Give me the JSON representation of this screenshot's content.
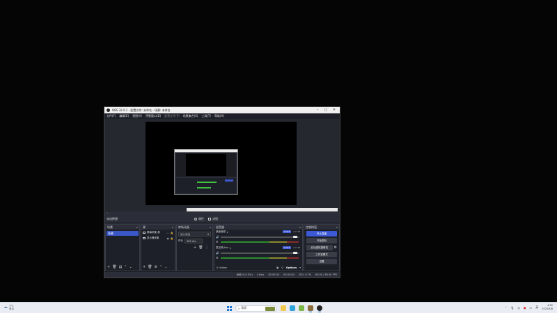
{
  "window": {
    "title": "OBS 32.0.1 - 配置文件: 未命名 - 场景: 未命名",
    "controls": [
      "–",
      "▢",
      "✕"
    ]
  },
  "menu": [
    {
      "label": "文件(F)",
      "dim": false
    },
    {
      "label": "编辑(E)",
      "dim": false
    },
    {
      "label": "视图(V)",
      "dim": false
    },
    {
      "label": "停靠窗口(D)",
      "dim": false
    },
    {
      "label": "配置文件(P)",
      "dim": true
    },
    {
      "label": "场景集合(S)",
      "dim": false
    },
    {
      "label": "工具(T)",
      "dim": false
    },
    {
      "label": "帮助(H)",
      "dim": false
    }
  ],
  "scene_bar": {
    "label": "未选择源",
    "properties": "属性",
    "filters": "滤镜"
  },
  "docks": {
    "scenes": {
      "title": "场景",
      "items": [
        "场景"
      ]
    },
    "sources": {
      "title": "源",
      "items": [
        {
          "label": "屏幕采集 源"
        },
        {
          "label": "显示器采集"
        }
      ]
    },
    "transitions": {
      "title": "转场动画",
      "selected": "淡入淡出",
      "duration_label": "时长",
      "duration_value": "300 ms"
    },
    "mixer": {
      "title": "混音器",
      "channels": [
        {
          "name": "桌面音频",
          "badge": "Global",
          "db": "0.0 dB"
        },
        {
          "name": "麦克风/Aux",
          "badge": "Global",
          "db": "0.0 dB"
        }
      ],
      "hidden": "0 hidden",
      "options": "Options"
    },
    "controls": {
      "title": "控制按钮",
      "buttons": [
        "停止直播",
        "开始录制",
        "启动虚拟摄像机",
        "工作室模式",
        "设置"
      ],
      "primary_index": 0
    }
  },
  "status": {
    "dropped": "丢帧 0 (0.0%)",
    "bitrate": "4 kb/s",
    "live": "00:00:00",
    "rec": "00:00:00",
    "cpu": "CPU: 0.7%",
    "fps": "60.00 / 60.00 FPS"
  },
  "taskbar": {
    "weather_temp": "7°C",
    "weather_desc": "多云",
    "search_placeholder": "搜索",
    "tray_lang": "英",
    "time": "4:52",
    "date": "2025/4/8"
  }
}
